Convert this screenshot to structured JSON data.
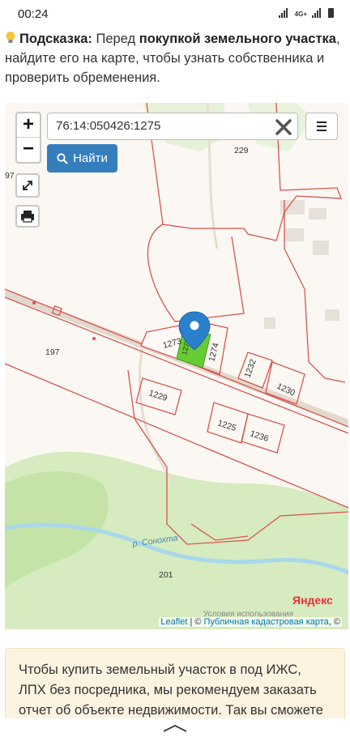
{
  "status_bar": {
    "time": "00:24",
    "network": "4G+"
  },
  "hint": {
    "label": "Подсказка:",
    "text_1": " Перед ",
    "bold_1": "покупкой земельного участка",
    "text_2": ", найдите его на карте, чтобы узнать собственника и проверить обременения."
  },
  "map": {
    "zoom_in": "+",
    "zoom_out": "−",
    "search_value": "76:14:050426:1275",
    "find_label": "Найти",
    "parcel_labels": {
      "p229": "229",
      "p197a": "97",
      "p197": "197",
      "p1273": "1273",
      "p1275": "1275",
      "p1274": "1274",
      "p1232": "1232",
      "p1230": "1230",
      "p1229": "1229",
      "p1225": "1225",
      "p1236": "1236",
      "p201": "201"
    },
    "river_label": "р. Сонохта",
    "provider_logo": "Яндекс",
    "provider_terms": "Условия использования",
    "attribution": {
      "leaflet": "Leaflet",
      "sep": " | © ",
      "source": "Публичная кадастровая карта",
      "suffix": ", ©"
    },
    "colors": {
      "parcel_border": "#d9534f",
      "selected_parcel": "#66cc33",
      "marker": "#2a81cb",
      "forest": "#cfe8b5",
      "river": "#9fd4e8"
    }
  },
  "cta": {
    "text": "Чтобы купить земельный участок в под ИЖС, ЛПХ без посредника, мы рекомендуем заказать отчет об объекте недвижимости. Так вы сможете"
  }
}
